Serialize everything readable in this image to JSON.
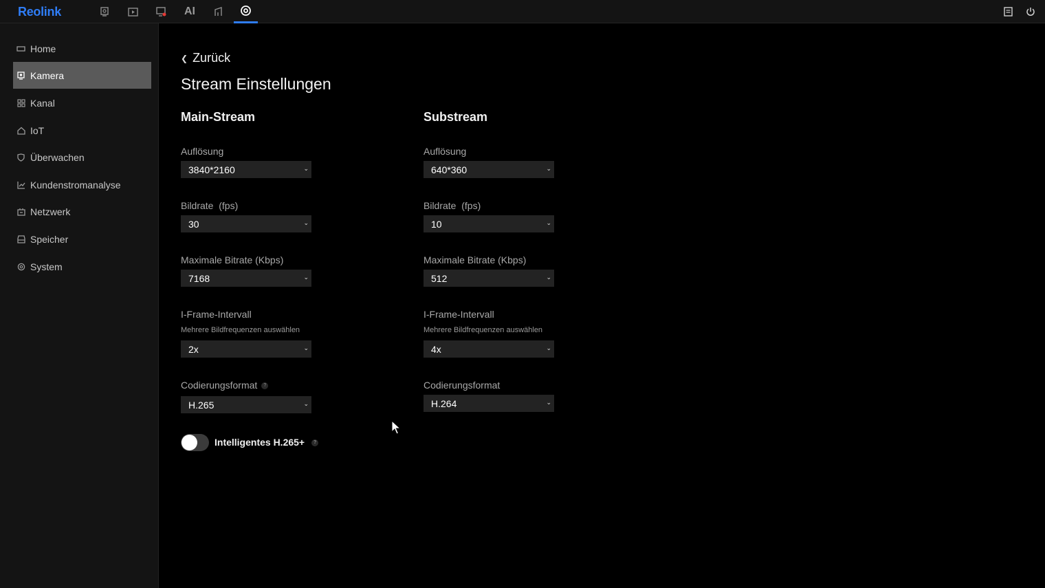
{
  "app": {
    "logo": "Reolink"
  },
  "topnav": {
    "ai_label": "AI",
    "items": [
      {
        "icon": "camera-live-icon"
      },
      {
        "icon": "playback-icon"
      },
      {
        "icon": "alarm-icon"
      },
      {
        "icon": "ai-text-icon"
      },
      {
        "icon": "device-icon"
      },
      {
        "icon": "settings-gear-icon",
        "active": true
      }
    ],
    "right": [
      {
        "icon": "notes-icon"
      },
      {
        "icon": "power-icon"
      }
    ]
  },
  "sidebar": {
    "items": [
      {
        "label": "Home",
        "icon": "home-icon"
      },
      {
        "label": "Kamera",
        "icon": "camera-icon",
        "active": true
      },
      {
        "label": "Kanal",
        "icon": "grid-icon"
      },
      {
        "label": "IoT",
        "icon": "house-icon"
      },
      {
        "label": "Überwachen",
        "icon": "shield-icon"
      },
      {
        "label": "Kundenstromanalyse",
        "icon": "chart-icon"
      },
      {
        "label": "Netzwerk",
        "icon": "network-icon"
      },
      {
        "label": "Speicher",
        "icon": "storage-icon"
      },
      {
        "label": "System",
        "icon": "system-gear-icon"
      }
    ]
  },
  "main": {
    "back_label": "Zurück",
    "title": "Stream Einstellungen",
    "main_stream": {
      "title": "Main-Stream",
      "resolution_label": "Auflösung",
      "resolution": "3840*2160",
      "framerate_label": "Bildrate  (fps)",
      "framerate": "30",
      "bitrate_label": "Maximale Bitrate (Kbps)",
      "bitrate": "7168",
      "iframe_label": "I-Frame-Intervall",
      "iframe_sublabel": "Mehrere Bildfrequenzen auswählen",
      "iframe": "2x",
      "codec_label": "Codierungsformat",
      "codec": "H.265"
    },
    "substream": {
      "title": "Substream",
      "resolution_label": "Auflösung",
      "resolution": "640*360",
      "framerate_label": "Bildrate  (fps)",
      "framerate": "10",
      "bitrate_label": "Maximale Bitrate (Kbps)",
      "bitrate": "512",
      "iframe_label": "I-Frame-Intervall",
      "iframe_sublabel": "Mehrere Bildfrequenzen auswählen",
      "iframe": "4x",
      "codec_label": "Codierungsformat",
      "codec": "H.264"
    },
    "smart_toggle": {
      "label": "Intelligentes H.265+",
      "enabled": false
    },
    "help_glyph": "?"
  },
  "colors": {
    "accent": "#2f7df6",
    "background": "#000000",
    "sidebar": "#141414",
    "select": "#232323"
  }
}
